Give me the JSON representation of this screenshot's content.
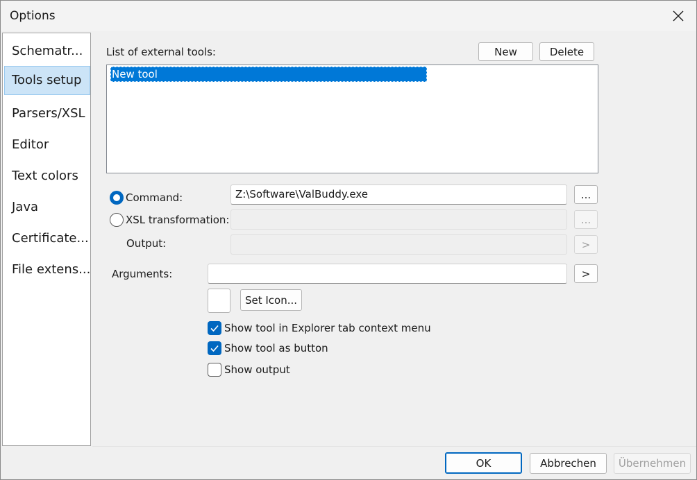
{
  "window": {
    "title": "Options",
    "close_glyph": "close-icon"
  },
  "nav": {
    "items": [
      {
        "label": "Schematr..."
      },
      {
        "label": "Tools setup",
        "selected": true
      },
      {
        "label": "Parsers/XSL"
      },
      {
        "label": "Editor"
      },
      {
        "label": "Text colors"
      },
      {
        "label": "Java"
      },
      {
        "label": "Certificate..."
      },
      {
        "label": "File extens..."
      }
    ]
  },
  "tools": {
    "list_label": "List of external tools:",
    "new_label": "New",
    "delete_label": "Delete",
    "items": [
      {
        "label": "New tool",
        "selected": true
      }
    ]
  },
  "command": {
    "radio_label": "Command:",
    "value": "Z:\\Software\\ValBuddy.exe",
    "browse_label": "...",
    "selected": true
  },
  "xsl": {
    "radio_label": "XSL transformation:",
    "value": "",
    "browse_label": "...",
    "selected": false
  },
  "output": {
    "label": "Output:",
    "value": "",
    "button_label": ">"
  },
  "arguments": {
    "label": "Arguments:",
    "value": "",
    "button_label": ">"
  },
  "icon": {
    "set_label": "Set Icon..."
  },
  "options": {
    "explorer_menu": {
      "label": "Show tool in Explorer tab context menu",
      "checked": true
    },
    "as_button": {
      "label": "Show tool as button",
      "checked": true
    },
    "show_output": {
      "label": "Show output",
      "checked": false
    }
  },
  "footer": {
    "ok_label": "OK",
    "cancel_label": "Abbrechen",
    "apply_label": "Übernehmen"
  },
  "colors": {
    "accent": "#0067c0",
    "selection": "#0078d7",
    "nav_selected": "#cce4f7"
  }
}
